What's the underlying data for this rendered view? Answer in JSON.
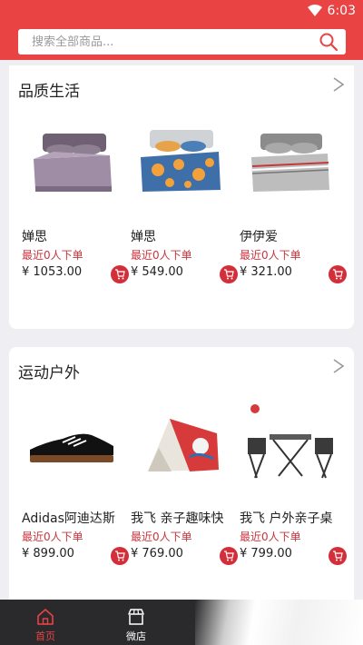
{
  "status": {
    "time": "6:03"
  },
  "search": {
    "placeholder": "搜索全部商品..."
  },
  "sections": [
    {
      "title": "品质生活",
      "products": [
        {
          "name": "婵思",
          "sales": "最近0人下单",
          "price": "¥ 1053.00"
        },
        {
          "name": "婵思",
          "sales": "最近0人下单",
          "price": "¥ 549.00"
        },
        {
          "name": "伊伊爱",
          "sales": "最近0人下单",
          "price": "¥ 321.00"
        }
      ]
    },
    {
      "title": "运动户外",
      "products": [
        {
          "name": "Adidas阿迪达斯",
          "sales": "最近0人下单",
          "price": "¥ 899.00"
        },
        {
          "name": "我飞 亲子趣味快",
          "sales": "最近0人下单",
          "price": "¥ 769.00"
        },
        {
          "name": "我飞 户外亲子桌",
          "sales": "最近0人下单",
          "price": "¥ 799.00"
        }
      ]
    }
  ],
  "tabbar": {
    "home_label": "首页",
    "shop_label": "微店"
  },
  "colors": {
    "accent": "#e94343",
    "cart": "#d22f3a",
    "sales": "#c9353d",
    "tabbar": "#2a2a2c"
  }
}
